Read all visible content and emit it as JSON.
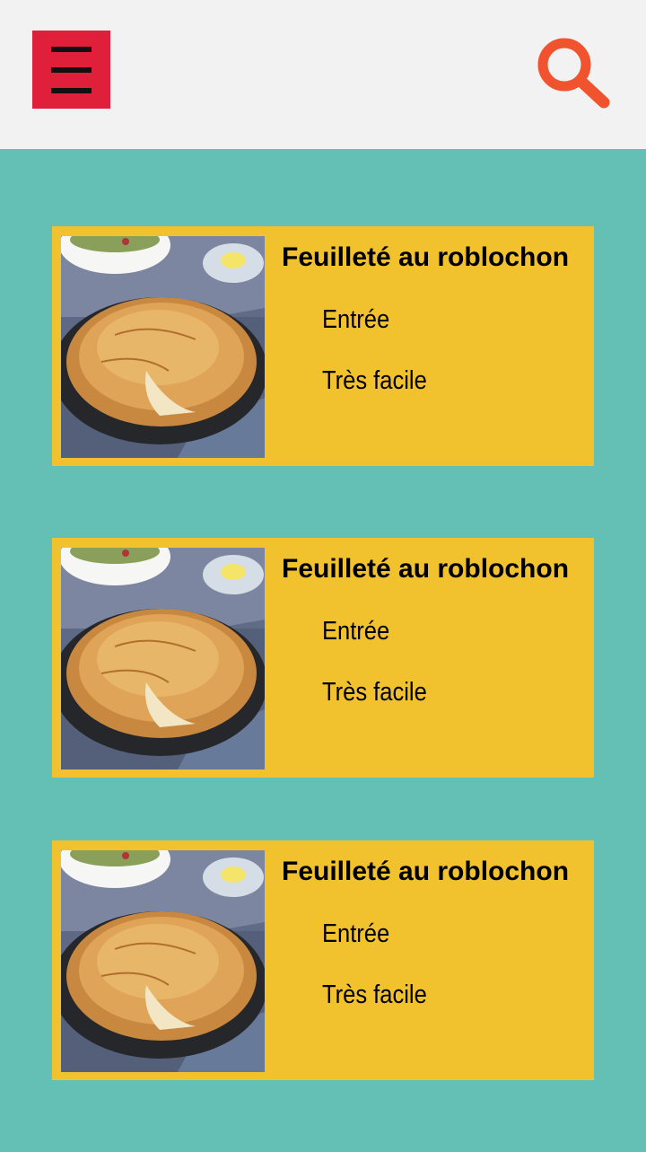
{
  "header": {
    "menu_icon": "hamburger-menu-icon",
    "search_icon": "magnifier-search-icon",
    "colors": {
      "background": "#f2f2f2",
      "menu_button": "#e0203a",
      "search_icon": "#f0532e"
    }
  },
  "colors": {
    "page_background": "#64bfb4",
    "card_background": "#f2c12e"
  },
  "recipes": [
    {
      "title": "Feuilleté au roblochon",
      "category": "Entrée",
      "difficulty": "Très facile"
    },
    {
      "title": "Feuilleté au roblochon",
      "category": "Entrée",
      "difficulty": "Très facile"
    },
    {
      "title": "Feuilleté au roblochon",
      "category": "Entrée",
      "difficulty": "Très facile"
    }
  ]
}
